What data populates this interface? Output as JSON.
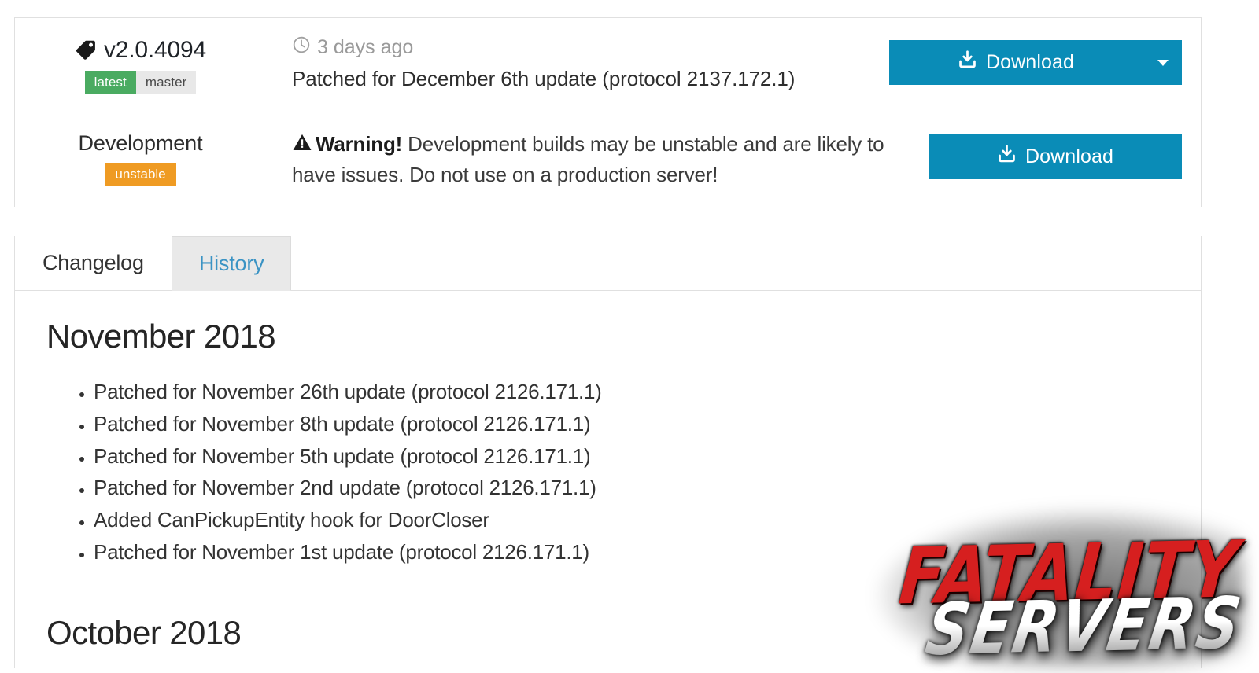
{
  "releases": [
    {
      "left_label": "v2.0.4094",
      "left_icon": "tag-icon",
      "badges": [
        {
          "text": "latest",
          "style": "latest"
        },
        {
          "text": "master",
          "style": "master"
        }
      ],
      "time_icon": "clock-icon",
      "time_text": "3 days ago",
      "description": "Patched for December 6th update (protocol 2137.172.1)",
      "download_label": "Download",
      "download_icon": "download-icon",
      "has_dropdown": true,
      "dropdown_icon": "chevron-down-icon"
    },
    {
      "left_label": "Development",
      "badges": [
        {
          "text": "unstable",
          "style": "unstable"
        }
      ],
      "warning_icon": "warning-triangle-icon",
      "warning_strong": "Warning!",
      "warning_text": " Development builds may be unstable and are likely to have issues. Do not use on a production server!",
      "download_label": "Download",
      "download_icon": "download-icon",
      "has_dropdown": false
    }
  ],
  "tabs": [
    {
      "label": "Changelog",
      "active": false
    },
    {
      "label": "History",
      "active": true
    }
  ],
  "history": {
    "sections": [
      {
        "heading": "November 2018",
        "items": [
          "Patched for November 26th update (protocol 2126.171.1)",
          "Patched for November 8th update (protocol 2126.171.1)",
          "Patched for November 5th update (protocol 2126.171.1)",
          "Patched for November 2nd update (protocol 2126.171.1)",
          "Added CanPickupEntity hook for DoorCloser",
          "Patched for November 1st update (protocol 2126.171.1)"
        ]
      },
      {
        "heading": "October 2018",
        "items": []
      }
    ]
  },
  "watermark": {
    "line1": "FATALITY",
    "line2": "SERVERS"
  },
  "colors": {
    "primary_blue": "#0a8cb7",
    "badge_green": "#4aab61",
    "badge_orange": "#ef9b23",
    "badge_gray": "#e8e8e8",
    "active_tab_text": "#3a93c4",
    "watermark_red": "#d61f1f"
  }
}
